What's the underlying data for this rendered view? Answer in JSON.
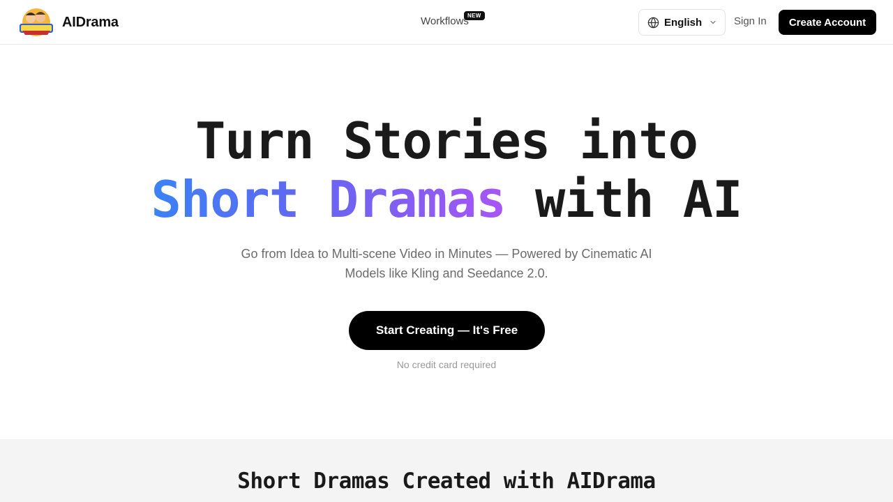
{
  "header": {
    "brand_name": "AIDrama",
    "logo_icon": "aidrama-logo-icon",
    "nav_workflows": "Workflows",
    "badge_new": "NEW",
    "language": {
      "selected": "English",
      "icon": "globe-icon",
      "chevron": "chevron-down-icon"
    },
    "sign_in": "Sign In",
    "create_account": "Create Account"
  },
  "hero": {
    "title_line1": "Turn Stories into",
    "title_highlight": "Short Dramas",
    "title_rest": " with AI",
    "subtitle": "Go from Idea to Multi-scene Video in Minutes — Powered by Cinematic AI Models like Kling and Seedance 2.0.",
    "cta": "Start Creating — It's Free",
    "note": "No credit card required"
  },
  "gallery": {
    "title": "Short Dramas Created with AIDrama"
  },
  "colors": {
    "accent_gradient_start": "#3b82f6",
    "accent_gradient_mid": "#6366f1",
    "accent_gradient_end": "#a855f7",
    "button_bg": "#000000",
    "section_bg": "#f4f4f4"
  }
}
